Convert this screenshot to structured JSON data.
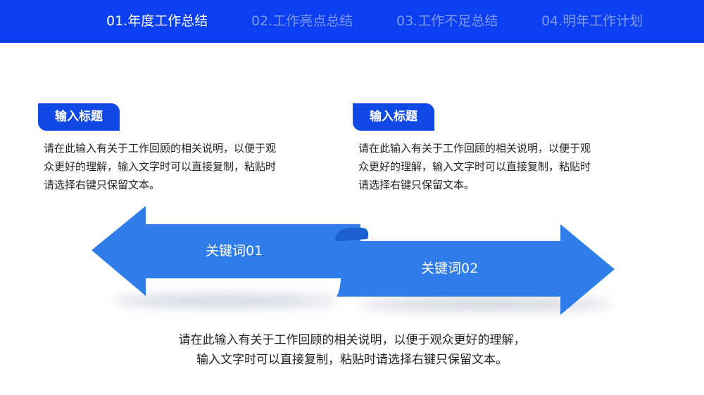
{
  "nav": {
    "tabs": [
      {
        "label": "01.年度工作总结",
        "active": true
      },
      {
        "label": "02.工作亮点总结",
        "active": false
      },
      {
        "label": "03.工作不足总结",
        "active": false
      },
      {
        "label": "04.明年工作计划",
        "active": false
      }
    ]
  },
  "blocks": [
    {
      "title": "输入标题",
      "lines": [
        "请在此输入有关于工作回顾的相关说明，以便于观",
        "众更好的理解，输入文字时可以直接复制，粘贴时",
        "请选择右键只保留文本。"
      ]
    },
    {
      "title": "输入标题",
      "lines": [
        "请在此输入有关于工作回顾的相关说明，以便于观",
        "众更好的理解，输入文字时可以直接复制，粘贴时",
        "请选择右键只保留文本。"
      ]
    }
  ],
  "arrows": {
    "left_keyword": "关键词01",
    "right_keyword": "关键词02"
  },
  "bottom": {
    "lines": [
      "请在此输入有关于工作回顾的相关说明，以便于观众更好的理解，",
      "输入文字时可以直接复制，粘贴时请选择右键只保留文本。"
    ]
  },
  "colors": {
    "nav_bg": "#0b3ff0",
    "badge_bg": "#1149e6",
    "arrow_fill": "#2f7de9",
    "arrow_fold": "#1c5fcf"
  }
}
